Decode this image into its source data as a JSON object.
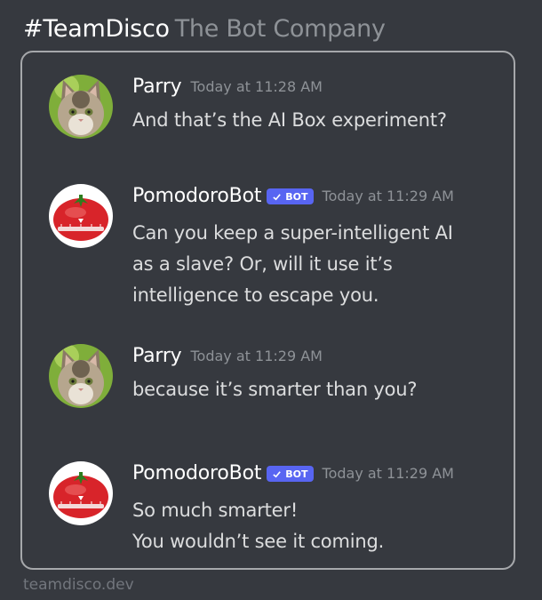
{
  "header": {
    "brand": "#TeamDisco",
    "tagline": "The Bot Company"
  },
  "footer": {
    "url": "teamdisco.dev"
  },
  "bot_tag_label": "BOT",
  "messages": [
    {
      "author": "Parry",
      "avatar": "cat-avatar",
      "timestamp": "Today at 11:28 AM",
      "lines": [
        "And that’s the AI Box experiment?"
      ]
    },
    {
      "author": "PomodoroBot",
      "avatar": "tomato-timer-avatar",
      "bot": true,
      "timestamp": "Today at 11:29 AM",
      "lines": [
        "Can you keep a super-intelligent AI",
        "as a slave?  Or, will it use it’s",
        "intelligence to escape you."
      ]
    },
    {
      "author": "Parry",
      "avatar": "cat-avatar",
      "timestamp": "Today at 11:29 AM",
      "lines": [
        "because it’s smarter than you?"
      ]
    },
    {
      "author": "PomodoroBot",
      "avatar": "tomato-timer-avatar",
      "bot": true,
      "timestamp": "Today at 11:29 AM",
      "lines": [
        "So much smarter!",
        "You wouldn’t see it coming."
      ]
    }
  ],
  "colors": {
    "background": "#36393f",
    "panel_border": "#a6a8ab",
    "bot_tag": "#5865f2",
    "message_text": "#dcddde",
    "timestamp": "#8e9297"
  }
}
